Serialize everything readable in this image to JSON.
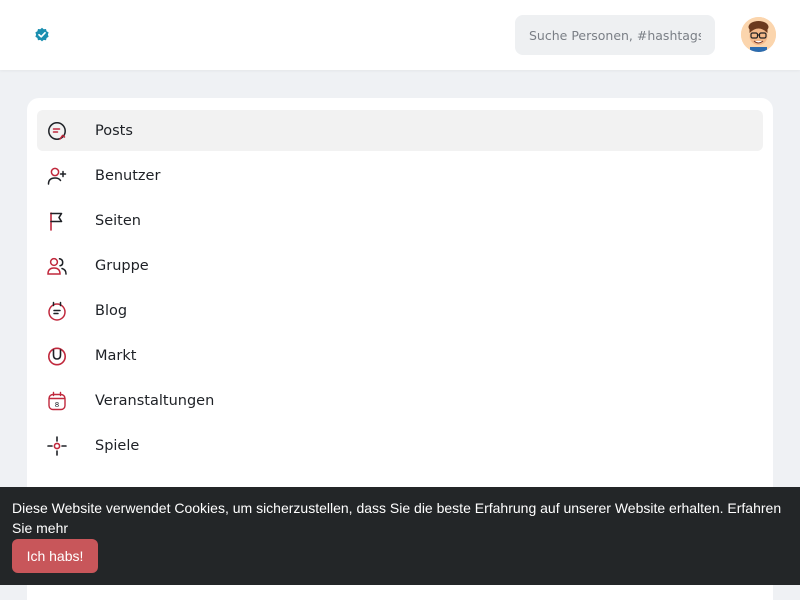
{
  "header": {
    "logo_icon": "verified-badge-icon",
    "search_placeholder": "Suche Personen, #hashtags",
    "avatar_icon": "memoji-avatar-icon"
  },
  "menu": {
    "items": [
      {
        "label": "Posts",
        "icon": "posts-icon",
        "active": true
      },
      {
        "label": "Benutzer",
        "icon": "add-user-icon"
      },
      {
        "label": "Seiten",
        "icon": "flag-icon"
      },
      {
        "label": "Gruppe",
        "icon": "group-icon"
      },
      {
        "label": "Blog",
        "icon": "blog-icon"
      },
      {
        "label": "Markt",
        "icon": "shopping-bag-icon"
      },
      {
        "label": "Veranstaltungen",
        "icon": "calendar-icon"
      },
      {
        "label": "Spiele",
        "icon": "crosshair-icon"
      }
    ]
  },
  "cookie_banner": {
    "text": "Diese Website verwendet Cookies, um sicherzustellen, dass Sie die beste Erfahrung auf unserer Website erhalten.",
    "learn_more": "Erfahren Sie mehr",
    "accept": "Ich habs!"
  },
  "colors": {
    "accent": "#c8565a",
    "icon": "#c0283c",
    "banner": "#232628"
  }
}
